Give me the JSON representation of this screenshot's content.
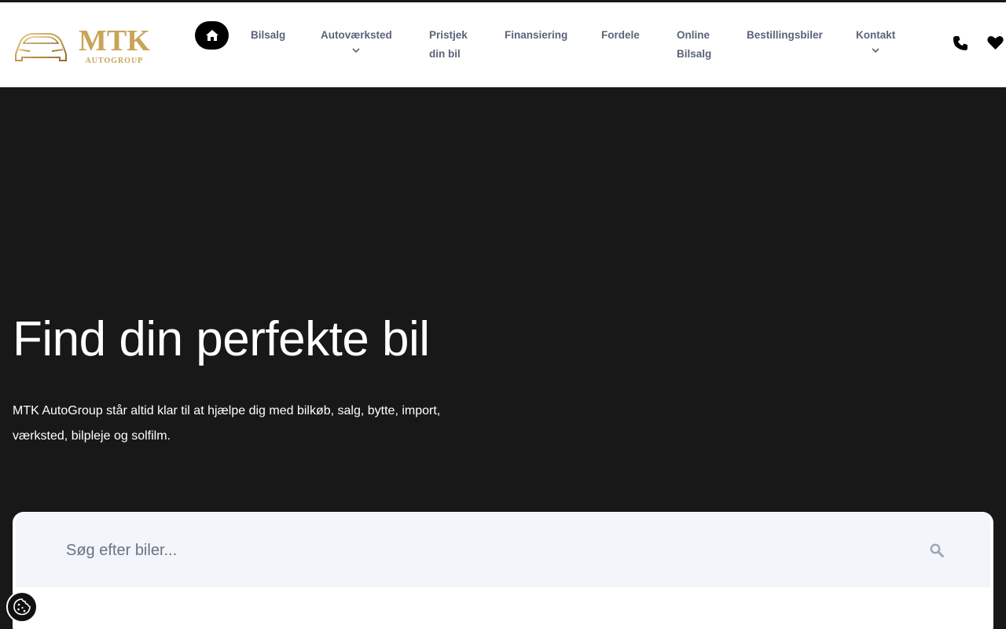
{
  "header": {
    "logo": {
      "name": "MTK",
      "subtitle": "AUTOGROUP"
    },
    "nav": [
      {
        "label": "Bilsalg"
      },
      {
        "label": "Autoværksted",
        "has_dropdown": true
      },
      {
        "label_line1": "Pristjek",
        "label_line2": "din bil"
      },
      {
        "label": "Finansiering"
      },
      {
        "label": "Fordele"
      },
      {
        "label_line1": "Online",
        "label_line2": "Bilsalg"
      },
      {
        "label": "Bestillingsbiler"
      },
      {
        "label": "Kontakt",
        "has_dropdown": true
      }
    ],
    "icons": {
      "home": "home-icon",
      "phone": "phone-icon",
      "favorites": "heart-icon"
    }
  },
  "hero": {
    "title": "Find din perfekte bil",
    "text": "MTK AutoGroup står altid klar til at hjælpe dig med bilkøb, salg, bytte, import, værksted, bilpleje og solfilm."
  },
  "search": {
    "placeholder": "Søg efter biler...",
    "value": "",
    "icon": "search-icon"
  },
  "cookie": {
    "icon": "cookie-icon"
  },
  "colors": {
    "background": "#181818",
    "header": "#ffffff",
    "nav_text": "#5a6478",
    "gold": "#c8a458",
    "search_field": "#f2f5fa"
  }
}
